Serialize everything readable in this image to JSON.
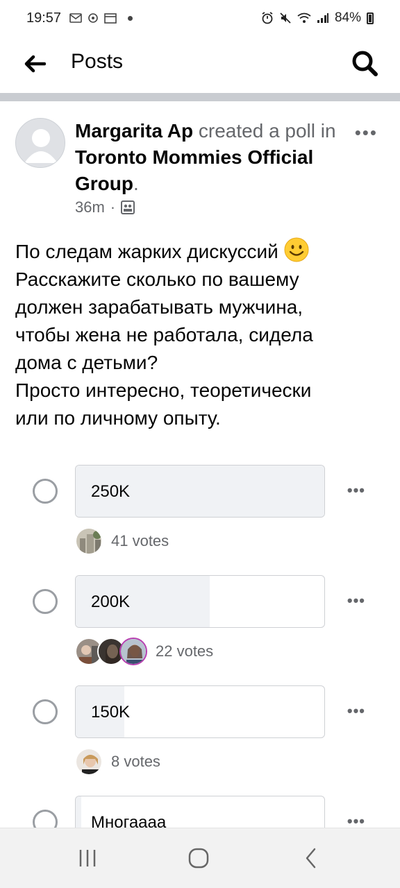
{
  "status_bar": {
    "time": "19:57",
    "battery": "84%"
  },
  "header": {
    "title": "Posts"
  },
  "post": {
    "author": "Margarita Ap",
    "action": "created a poll in",
    "group": "Toronto Mommies Official Group",
    "time": "36m",
    "text_lines": [
      "По следам жарких дискуссий",
      "Расскажите сколько по вашему",
      "должен зарабатывать мужчина,",
      "чтобы жена не работала, сидела",
      "дома с детьми?",
      "Просто интересно, теоретически",
      "или по личному опыту."
    ]
  },
  "poll": {
    "options": [
      {
        "label": "250K",
        "votes_text": "41 votes",
        "votes": 41,
        "fill": 1.0
      },
      {
        "label": "200K",
        "votes_text": "22 votes",
        "votes": 22,
        "fill": 0.54
      },
      {
        "label": "150K",
        "votes_text": "8 votes",
        "votes": 8,
        "fill": 0.195
      },
      {
        "label": "Многаааа"
      }
    ]
  },
  "colors": {
    "accent_text": "#050505",
    "secondary_text": "#65676b",
    "bar_fill": "#f0f2f5",
    "divider": "#c9ccd1"
  }
}
